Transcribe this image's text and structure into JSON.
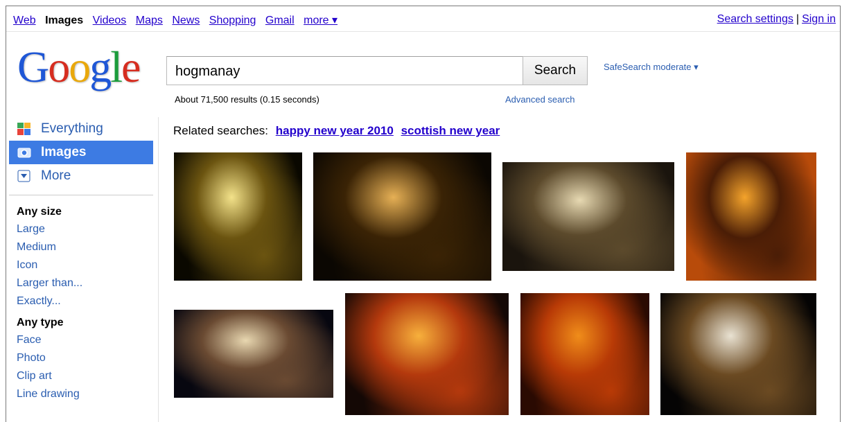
{
  "topnav": {
    "items": [
      "Web",
      "Images",
      "Videos",
      "Maps",
      "News",
      "Shopping",
      "Gmail",
      "more ▾"
    ],
    "current": "Images",
    "search_settings": "Search settings",
    "separator": "|",
    "sign_in": "Sign in"
  },
  "logo": {
    "letters": [
      "G",
      "o",
      "o",
      "g",
      "l",
      "e"
    ]
  },
  "search": {
    "query": "hogmanay",
    "button": "Search",
    "safesearch": "SafeSearch moderate ▾",
    "stats": "About 71,500 results (0.15 seconds)",
    "advanced": "Advanced search"
  },
  "sidebar": {
    "modes": [
      {
        "label": "Everything",
        "icon": "everything-icon"
      },
      {
        "label": "Images",
        "icon": "camera-icon",
        "active": true
      },
      {
        "label": "More",
        "icon": "dropdown-icon"
      }
    ],
    "size_heading": "Any size",
    "sizes": [
      "Large",
      "Medium",
      "Icon",
      "Larger than...",
      "Exactly..."
    ],
    "type_heading": "Any type",
    "types": [
      "Face",
      "Photo",
      "Clip art",
      "Line drawing"
    ]
  },
  "related": {
    "label": "Related searches:",
    "links": [
      "happy new year 2010",
      "scottish new year"
    ]
  },
  "results": {
    "images": [
      {
        "subject": "fireworks over castle",
        "palette": [
          "#0a0800",
          "#f3e28a",
          "#6b5410"
        ]
      },
      {
        "subject": "ferris wheel at night",
        "palette": [
          "#0b0702",
          "#e6b055",
          "#3a2305"
        ]
      },
      {
        "subject": "crowd in square",
        "palette": [
          "#1a140d",
          "#e7d9b2",
          "#5c4a2c"
        ]
      },
      {
        "subject": "torch procession",
        "palette": [
          "#b84b0a",
          "#f4a32b",
          "#4a1d06"
        ]
      },
      {
        "subject": "fireworks over crowd",
        "palette": [
          "#070710",
          "#e8d7b0",
          "#6a4a32"
        ]
      },
      {
        "subject": "silhouettes with flag and fire",
        "palette": [
          "#140805",
          "#f7b03c",
          "#b4390d"
        ]
      },
      {
        "subject": "viking longship burning",
        "palette": [
          "#2a0a02",
          "#f08d1a",
          "#b83a06"
        ]
      },
      {
        "subject": "fireworks over town",
        "palette": [
          "#050404",
          "#e9e2d2",
          "#6b4a22"
        ]
      }
    ]
  }
}
